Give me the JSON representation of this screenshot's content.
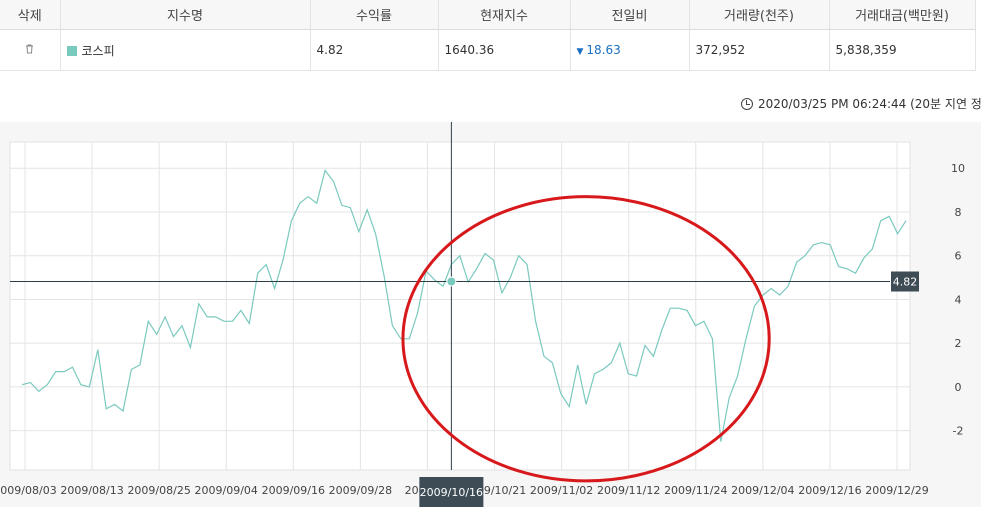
{
  "table": {
    "headers": [
      "삭제",
      "지수명",
      "수익률",
      "현재지수",
      "전일비",
      "거래량(천주)",
      "거래대금(백만원)"
    ],
    "row": {
      "delete_icon": "trash-icon",
      "name": "코스피",
      "swatch_color": "#7ac9bf",
      "return": "4.82",
      "current": "1640.36",
      "change_dir": "down",
      "change": "18.63",
      "volume": "372,952",
      "amount": "5,838,359"
    }
  },
  "timestamp": "2020/03/25 PM 06:24:44 (20분 지연 정.",
  "chart_data": {
    "type": "line",
    "x_tick_labels": [
      "2009/08/03",
      "2009/08/13",
      "2009/08/25",
      "2009/09/04",
      "2009/09/16",
      "2009/09/28",
      "2009/10",
      "2009/10/21",
      "2009/11/02",
      "2009/11/12",
      "2009/11/24",
      "2009/12/04",
      "2009/12/16",
      "2009/12/29"
    ],
    "y_ticks": [
      10,
      8,
      6,
      4,
      2,
      0,
      -2
    ],
    "ylim": [
      -3.8,
      11.2
    ],
    "series": [
      {
        "color": "#7ac9bf",
        "values": [
          0.1,
          0.2,
          -0.2,
          0.1,
          0.7,
          0.7,
          0.9,
          0.1,
          0.0,
          1.7,
          -1.0,
          -0.8,
          -1.1,
          0.8,
          1.0,
          3.0,
          2.4,
          3.2,
          2.3,
          2.8,
          1.8,
          3.8,
          3.2,
          3.2,
          3.0,
          3.0,
          3.5,
          2.9,
          5.2,
          5.6,
          4.5,
          5.8,
          7.6,
          8.4,
          8.7,
          8.4,
          9.9,
          9.4,
          8.3,
          8.2,
          7.1,
          8.1,
          7.0,
          5.1,
          2.8,
          2.2,
          2.2,
          3.4,
          5.3,
          4.9,
          4.6,
          5.6,
          6.0,
          4.8,
          5.4,
          6.1,
          5.8,
          4.3,
          5.0,
          6.0,
          5.6,
          3.0,
          1.4,
          1.1,
          -0.3,
          -0.9,
          1.0,
          -0.8,
          0.6,
          0.8,
          1.1,
          2.0,
          0.6,
          0.5,
          1.9,
          1.4,
          2.6,
          3.6,
          3.6,
          3.5,
          2.8,
          3.0,
          2.2,
          -2.5,
          -0.5,
          0.5,
          2.2,
          3.7,
          4.2,
          4.5,
          4.2,
          4.6,
          5.7,
          6.0,
          6.5,
          6.6,
          6.5,
          5.5,
          5.4,
          5.2,
          5.9,
          6.3,
          7.6,
          7.8,
          7.0,
          7.6
        ]
      }
    ],
    "crosshair": {
      "date_label": "2009/10/16",
      "value_label": "4.82",
      "value": 4.82,
      "index": 51
    },
    "annotation": {
      "shape": "ellipse",
      "color": "#d7191c",
      "x_index_range": [
        50,
        84
      ],
      "y_range": [
        -4.3,
        8.7
      ]
    },
    "grid": true,
    "y_axis_side": "right"
  }
}
